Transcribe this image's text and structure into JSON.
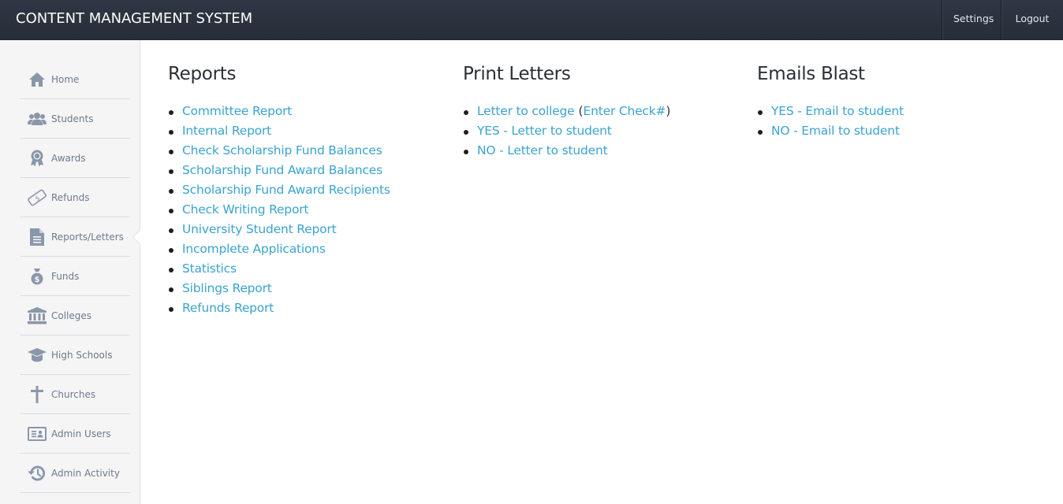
{
  "header": {
    "title": "CONTENT MANAGEMENT SYSTEM",
    "nav": [
      {
        "label": "Settings"
      },
      {
        "label": "Logout"
      }
    ]
  },
  "sidebar": {
    "active": "Reports/Letters",
    "items": [
      {
        "label": "Home",
        "icon": "home-icon"
      },
      {
        "label": "Students",
        "icon": "users-icon"
      },
      {
        "label": "Awards",
        "icon": "award-ribbon-icon"
      },
      {
        "label": "Refunds",
        "icon": "money-bill-icon"
      },
      {
        "label": "Reports/Letters",
        "icon": "document-icon"
      },
      {
        "label": "Funds",
        "icon": "money-bag-icon"
      },
      {
        "label": "Colleges",
        "icon": "institution-icon"
      },
      {
        "label": "High Schools",
        "icon": "graduation-cap-icon"
      },
      {
        "label": "Churches",
        "icon": "cross-icon"
      },
      {
        "label": "Admin Users",
        "icon": "id-card-icon"
      },
      {
        "label": "Admin Activity",
        "icon": "history-icon"
      }
    ]
  },
  "main": {
    "reports": {
      "title": "Reports",
      "links": [
        "Committee Report",
        "Internal Report",
        "Check Scholarship Fund Balances",
        "Scholarship Fund Award Balances",
        "Scholarship Fund Award Recipients",
        "Check Writing Report",
        "University Student Report",
        "Incomplete Applications",
        "Statistics",
        "Siblings Report",
        "Refunds Report"
      ]
    },
    "print_letters": {
      "title": "Print Letters",
      "letter_to_college": "Letter to college",
      "paren_open": "(",
      "enter_check": "Enter Check#",
      "paren_close": ")",
      "links": [
        "YES - Letter to student",
        "NO - Letter to student"
      ]
    },
    "emails_blast": {
      "title": "Emails Blast",
      "links": [
        "YES - Email to student",
        "NO - Email to student"
      ]
    }
  },
  "colors": {
    "topbar": "#2b323e",
    "link": "#3ba3cf",
    "sidebar_bg": "#f5f5f5",
    "sidebar_icon": "#8a97ab",
    "sidebar_text": "#6d7a90"
  }
}
